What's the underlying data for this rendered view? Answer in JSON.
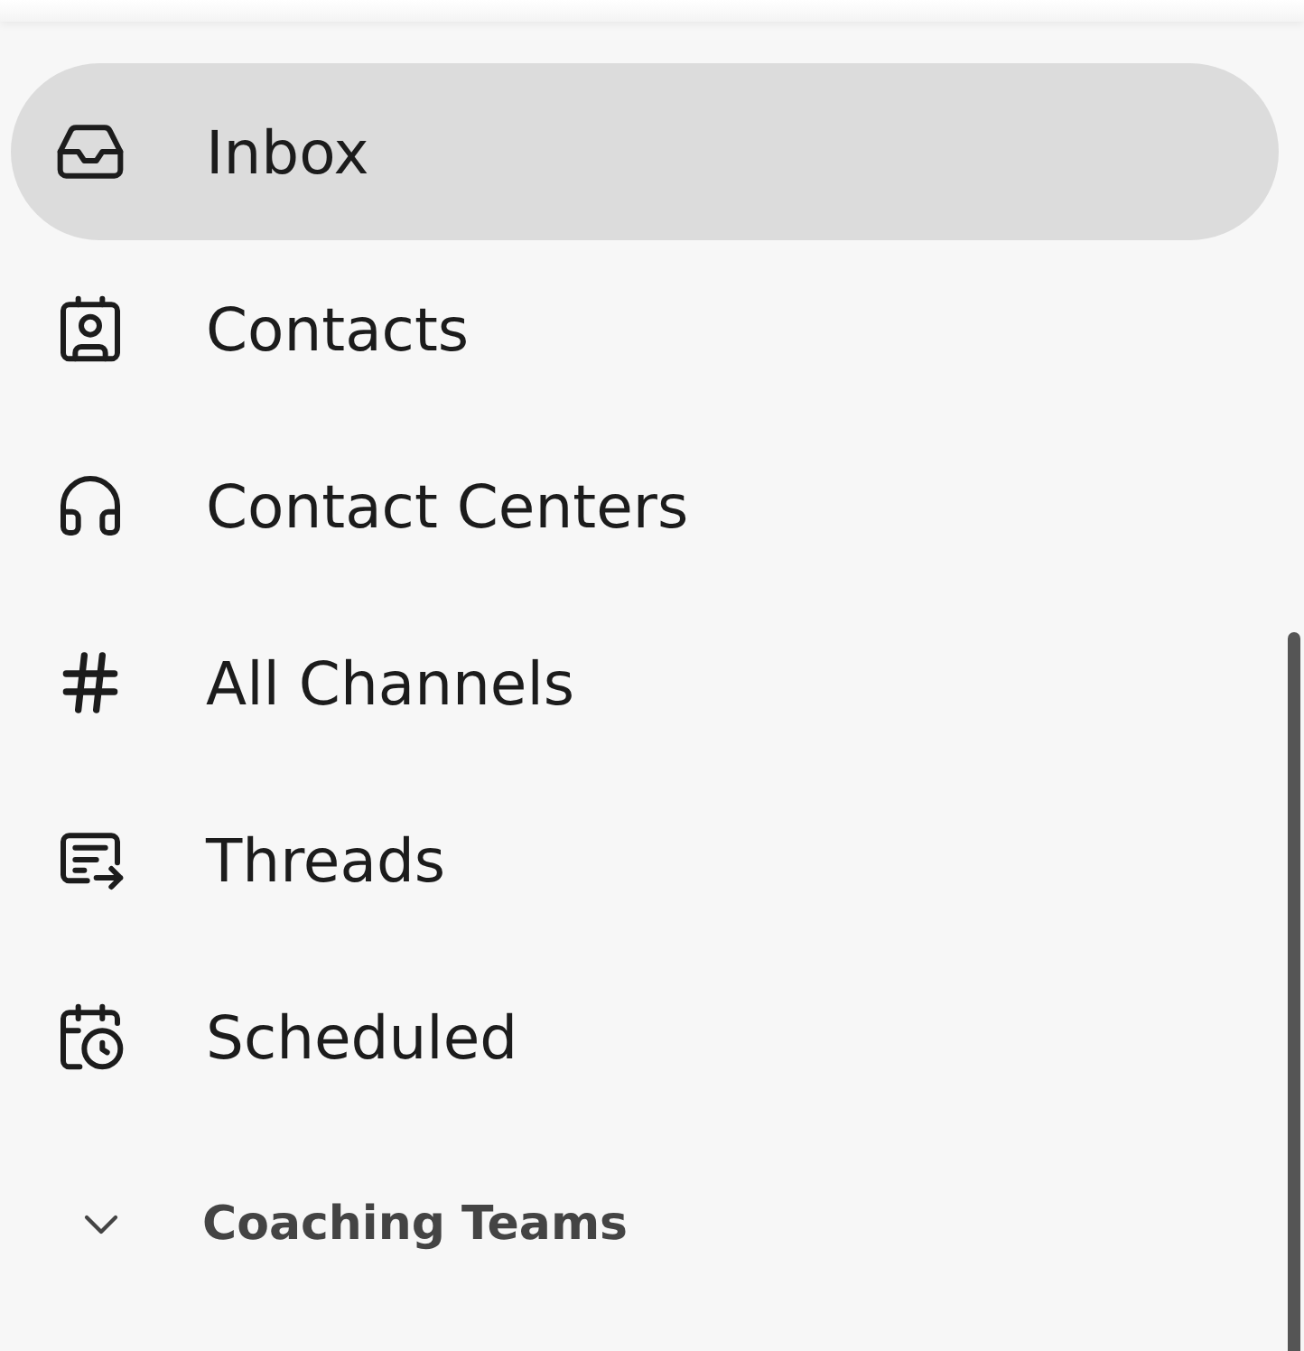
{
  "nav_items": [
    {
      "label": "Inbox",
      "selected": true
    },
    {
      "label": "Contacts",
      "selected": false
    },
    {
      "label": "Contact Centers",
      "selected": false
    },
    {
      "label": "All Channels",
      "selected": false
    },
    {
      "label": "Threads",
      "selected": false
    },
    {
      "label": "Scheduled",
      "selected": false
    }
  ],
  "section": {
    "label": "Coaching Teams",
    "expanded": true
  }
}
